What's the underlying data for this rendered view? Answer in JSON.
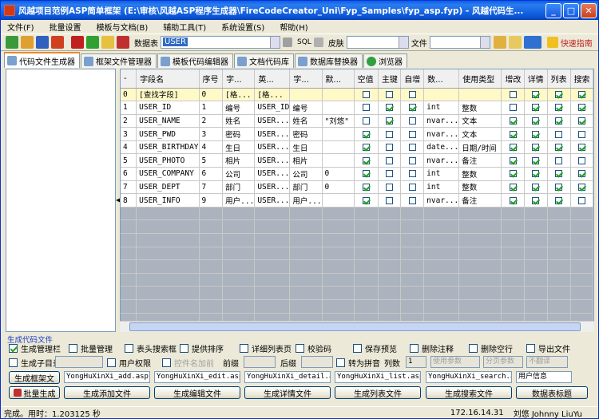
{
  "window": {
    "title": "风越项目范例ASP简单框架 (E:\\审核\\风越ASP程序生成器\\FireCodeCreator_Uni\\Fyp_Samples\\fyp_asp.fyp)  - 风越代码生..."
  },
  "menu": [
    "文件(F)",
    "批量设置",
    "模板与文档(B)",
    "辅助工具(T)",
    "系统设置(S)",
    "帮助(H)"
  ],
  "toolbar": {
    "db_label": "数据表",
    "db_value": "USER",
    "sql_label": "SQL",
    "skin_label": "皮肤",
    "file_label": "文件",
    "quick_guide": "快速指南"
  },
  "tabs": [
    "代码文件生成器",
    "框架文件管理器",
    "模板代码编辑器",
    "文档代码库",
    "数据库替换器",
    "浏览器"
  ],
  "grid": {
    "headers": [
      "-",
      "字段名",
      "序号",
      "字...",
      "英...",
      "字...",
      "默...",
      "空值",
      "主键",
      "自增",
      "数...",
      "使用类型",
      "增改",
      "详情",
      "列表",
      "搜索"
    ],
    "rows": [
      {
        "c": [
          "0",
          "[查找字段]",
          "0",
          "[格...",
          "[格...",
          "",
          "",
          "",
          "",
          "",
          "",
          "",
          "",
          "",
          "",
          ""
        ],
        "chk": [
          0,
          0,
          0,
          0,
          1,
          1,
          1
        ]
      },
      {
        "c": [
          "1",
          "USER_ID",
          "1",
          "编号",
          "USER_ID",
          "编号",
          "",
          "",
          "",
          "",
          "int",
          "整数",
          "",
          "",
          "",
          ""
        ],
        "chk": [
          0,
          1,
          1,
          0,
          1,
          1,
          1
        ]
      },
      {
        "c": [
          "2",
          "USER_NAME",
          "2",
          "姓名",
          "USER...",
          "姓名",
          "\"刘悠\"",
          "",
          "",
          "",
          "nvar...",
          "文本",
          "",
          "",
          "",
          ""
        ],
        "chk": [
          0,
          1,
          0,
          1,
          1,
          1,
          1
        ]
      },
      {
        "c": [
          "3",
          "USER_PWD",
          "3",
          "密码",
          "USER...",
          "密码",
          "",
          "",
          "",
          "",
          "nvar...",
          "文本",
          "",
          "",
          "",
          ""
        ],
        "chk": [
          1,
          0,
          0,
          1,
          1,
          0,
          0
        ]
      },
      {
        "c": [
          "4",
          "USER_BIRTHDAY",
          "4",
          "生日",
          "USER...",
          "生日",
          "",
          "",
          "",
          "",
          "date...",
          "日期/时间",
          "",
          "",
          "",
          ""
        ],
        "chk": [
          1,
          0,
          0,
          1,
          1,
          1,
          1
        ]
      },
      {
        "c": [
          "5",
          "USER_PHOTO",
          "5",
          "相片",
          "USER...",
          "相片",
          "",
          "",
          "",
          "",
          "nvar...",
          "备注",
          "",
          "",
          "",
          ""
        ],
        "chk": [
          1,
          0,
          0,
          1,
          1,
          0,
          0
        ]
      },
      {
        "c": [
          "6",
          "USER_COMPANY",
          "6",
          "公司",
          "USER...",
          "公司",
          "0",
          "",
          "",
          "",
          "int",
          "整数",
          "",
          "",
          "",
          ""
        ],
        "chk": [
          1,
          0,
          0,
          1,
          1,
          1,
          1
        ]
      },
      {
        "c": [
          "7",
          "USER_DEPT",
          "7",
          "部门",
          "USER...",
          "部门",
          "0",
          "",
          "",
          "",
          "int",
          "整数",
          "",
          "",
          "",
          ""
        ],
        "chk": [
          1,
          0,
          0,
          1,
          1,
          1,
          1
        ]
      },
      {
        "c": [
          "8",
          "USER_INFO",
          "9",
          "用户...",
          "USER...",
          "用户...",
          "",
          "",
          "",
          "",
          "nvar...",
          "备注",
          "",
          "",
          "",
          ""
        ],
        "chk": [
          1,
          0,
          0,
          1,
          1,
          1,
          0
        ]
      }
    ]
  },
  "bottom": {
    "section": "生成代码文件",
    "opts1": [
      "生成管理栏",
      "批量管理",
      "表头搜索框",
      "提供排序",
      "详细列表页",
      "校验码",
      "保存预览",
      "删除注释",
      "删除空行",
      "导出文件"
    ],
    "opts2": [
      "生成子目录",
      "用户权限",
      "控件名加前",
      "前缀",
      "后缀",
      "转为拼音",
      "列数",
      "使用参数",
      "分页参数",
      "不翻译"
    ],
    "cols_value": "1",
    "gen_frame": "生成框架文",
    "files": [
      "YongHuXinXi_add.asp",
      "YongHuXinXi_edit.asp",
      "YongHuXinXi_detail.asp",
      "YongHuXinXi_list.asp",
      "YongHuXinXi_search.asp",
      "用户信息"
    ],
    "buttons": [
      "批量生成",
      "生成添加文件",
      "生成编辑文件",
      "生成详情文件",
      "生成列表文件",
      "生成搜索文件",
      "数据表标题"
    ]
  },
  "status": {
    "text": "完成。用时：1.203125 秒",
    "ip": "172.16.14.31",
    "user": "刘悠 Johnny LiuYu"
  }
}
